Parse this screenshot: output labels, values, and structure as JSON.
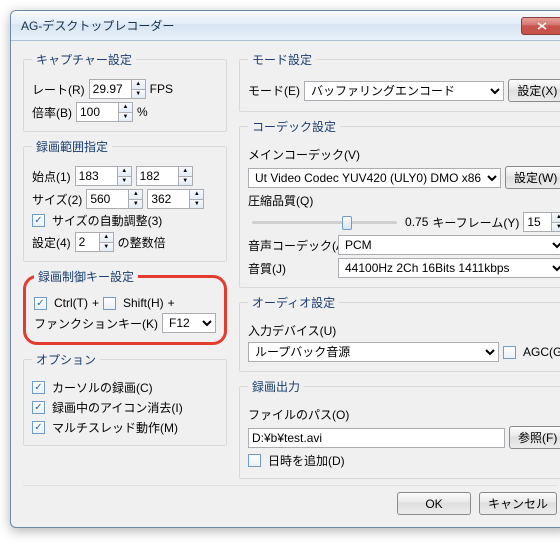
{
  "window": {
    "title": "AG-デスクトップレコーダー"
  },
  "capture": {
    "legend": "キャプチャー設定",
    "rate_label": "レート(R)",
    "rate": "29.97",
    "rate_unit": "FPS",
    "scale_label": "倍率(B)",
    "scale": "100",
    "scale_unit": "%"
  },
  "range": {
    "legend": "録画範囲指定",
    "start_label": "始点(1)",
    "start_x": "183",
    "start_y": "182",
    "size_label": "サイズ(2)",
    "size_w": "560",
    "size_h": "362",
    "auto_label": "サイズの自動調整(3)",
    "mult_label1": "設定(4)",
    "mult_val": "2",
    "mult_label2": "の整数倍"
  },
  "hotkey": {
    "legend": "録画制御キー設定",
    "ctrl": "Ctrl(T)",
    "plus": "+",
    "shift": "Shift(H)",
    "fn_label": "ファンクションキー(K)",
    "fn_val": "F12"
  },
  "options": {
    "legend": "オプション",
    "cursor": "カーソルの録画(C)",
    "hideicon": "録画中のアイコン消去(I)",
    "multithread": "マルチスレッド動作(M)"
  },
  "mode": {
    "legend": "モード設定",
    "label": "モード(E)",
    "val": "バッファリングエンコード",
    "btn": "設定(X)"
  },
  "codec": {
    "legend": "コーデック設定",
    "main_label": "メインコーデック(V)",
    "main_val": "Ut Video Codec YUV420 (ULY0) DMO x86",
    "btn": "設定(W)",
    "quality_label": "圧縮品質(Q)",
    "quality_val": "0.75",
    "keyframe_label": "キーフレーム(Y)",
    "keyframe_val": "15",
    "audio_codec_label": "音声コーデック(A)",
    "audio_codec_val": "PCM",
    "audio_q_label": "音質(J)",
    "audio_q_val": "44100Hz 2Ch 16Bits 1411kbps"
  },
  "audio": {
    "legend": "オーディオ設定",
    "device_label": "入力デバイス(U)",
    "device_val": "ループバック音源",
    "agc": "AGC(G)"
  },
  "output": {
    "legend": "録画出力",
    "path_label": "ファイルのパス(O)",
    "path_val": "D:¥b¥test.avi",
    "browse": "参照(F)",
    "datetime": "日時を追加(D)"
  },
  "footer": {
    "ok": "OK",
    "cancel": "キャンセル"
  }
}
